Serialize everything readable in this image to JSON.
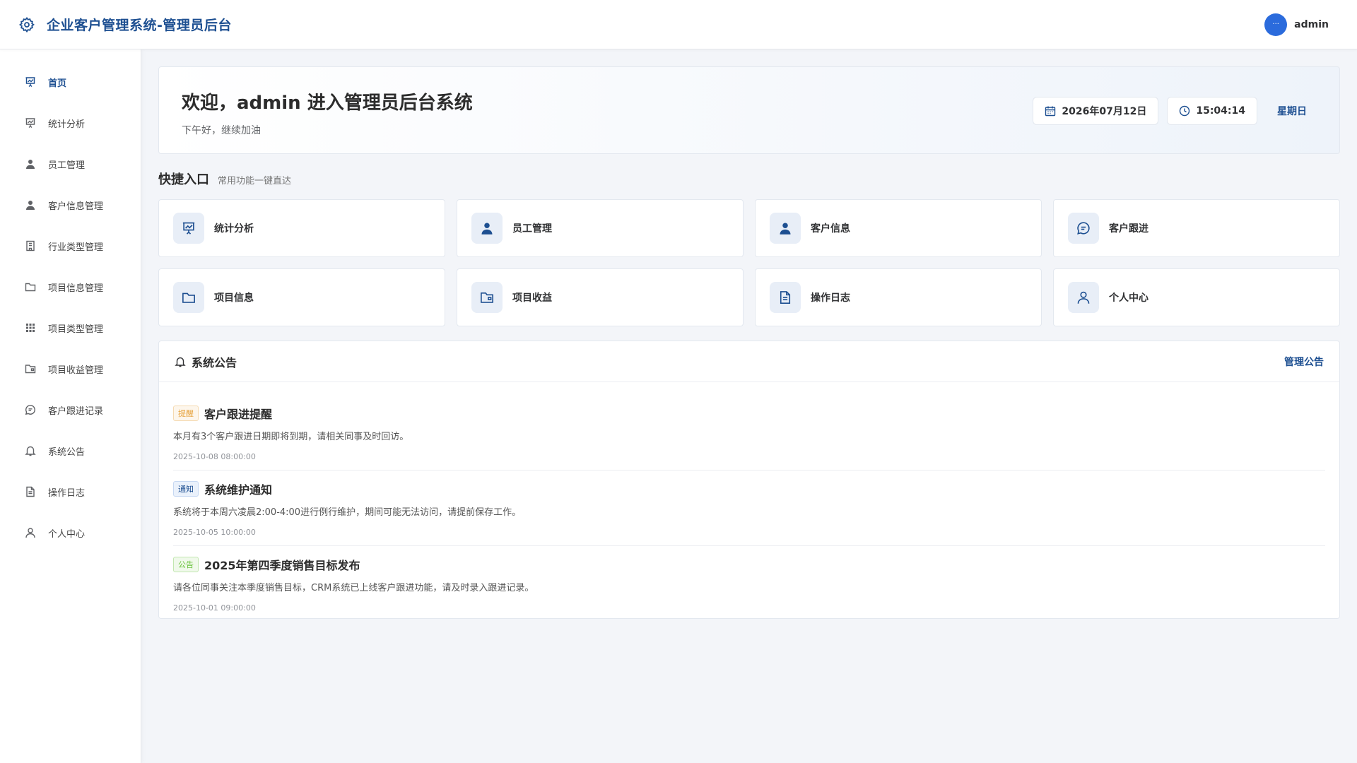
{
  "header": {
    "title": "企业客户管理系统-管理员后台",
    "avatar_text": "···",
    "username": "admin"
  },
  "sidebar": {
    "items": [
      {
        "label": "首页",
        "icon": "presentation-chart-icon",
        "active": true
      },
      {
        "label": "统计分析",
        "icon": "presentation-chart-icon"
      },
      {
        "label": "员工管理",
        "icon": "user-icon"
      },
      {
        "label": "客户信息管理",
        "icon": "user-icon"
      },
      {
        "label": "行业类型管理",
        "icon": "building-icon"
      },
      {
        "label": "项目信息管理",
        "icon": "folder-icon"
      },
      {
        "label": "项目类型管理",
        "icon": "grid-icon"
      },
      {
        "label": "项目收益管理",
        "icon": "wallet-folder-icon"
      },
      {
        "label": "客户跟进记录",
        "icon": "chat-icon"
      },
      {
        "label": "系统公告",
        "icon": "bell-icon"
      },
      {
        "label": "操作日志",
        "icon": "document-icon"
      },
      {
        "label": "个人中心",
        "icon": "user-outline-icon"
      }
    ]
  },
  "welcome": {
    "title": "欢迎，admin 进入管理员后台系统",
    "subtitle": "下午好，继续加油",
    "date": "2026年07月12日",
    "time": "15:04:14",
    "weekday": "星期日"
  },
  "quick": {
    "title": "快捷入口",
    "subtitle": "常用功能一键直达",
    "cards": [
      {
        "label": "统计分析",
        "icon": "presentation-chart-icon"
      },
      {
        "label": "员工管理",
        "icon": "user-icon"
      },
      {
        "label": "客户信息",
        "icon": "user-icon"
      },
      {
        "label": "客户跟进",
        "icon": "chat-icon"
      },
      {
        "label": "项目信息",
        "icon": "folder-icon"
      },
      {
        "label": "项目收益",
        "icon": "wallet-folder-icon"
      },
      {
        "label": "操作日志",
        "icon": "document-icon"
      },
      {
        "label": "个人中心",
        "icon": "user-outline-icon"
      }
    ]
  },
  "notice": {
    "title": "系统公告",
    "manage_label": "管理公告",
    "items": [
      {
        "tag": "提醒",
        "tag_type": "warn",
        "title": "客户跟进提醒",
        "desc": "本月有3个客户跟进日期即将到期，请相关同事及时回访。",
        "time": "2025-10-08 08:00:00"
      },
      {
        "tag": "通知",
        "tag_type": "info",
        "title": "系统维护通知",
        "desc": "系统将于本周六凌晨2:00-4:00进行例行维护，期间可能无法访问，请提前保存工作。",
        "time": "2025-10-05 10:00:00"
      },
      {
        "tag": "公告",
        "tag_type": "ok",
        "title": "2025年第四季度销售目标发布",
        "desc": "请各位同事关注本季度销售目标，CRM系统已上线客户跟进功能，请及时录入跟进记录。",
        "time": "2025-10-01 09:00:00"
      }
    ]
  },
  "colors": {
    "primary": "#1d4f91",
    "avatar": "#2b6bdc",
    "background": "#f3f5f9"
  }
}
